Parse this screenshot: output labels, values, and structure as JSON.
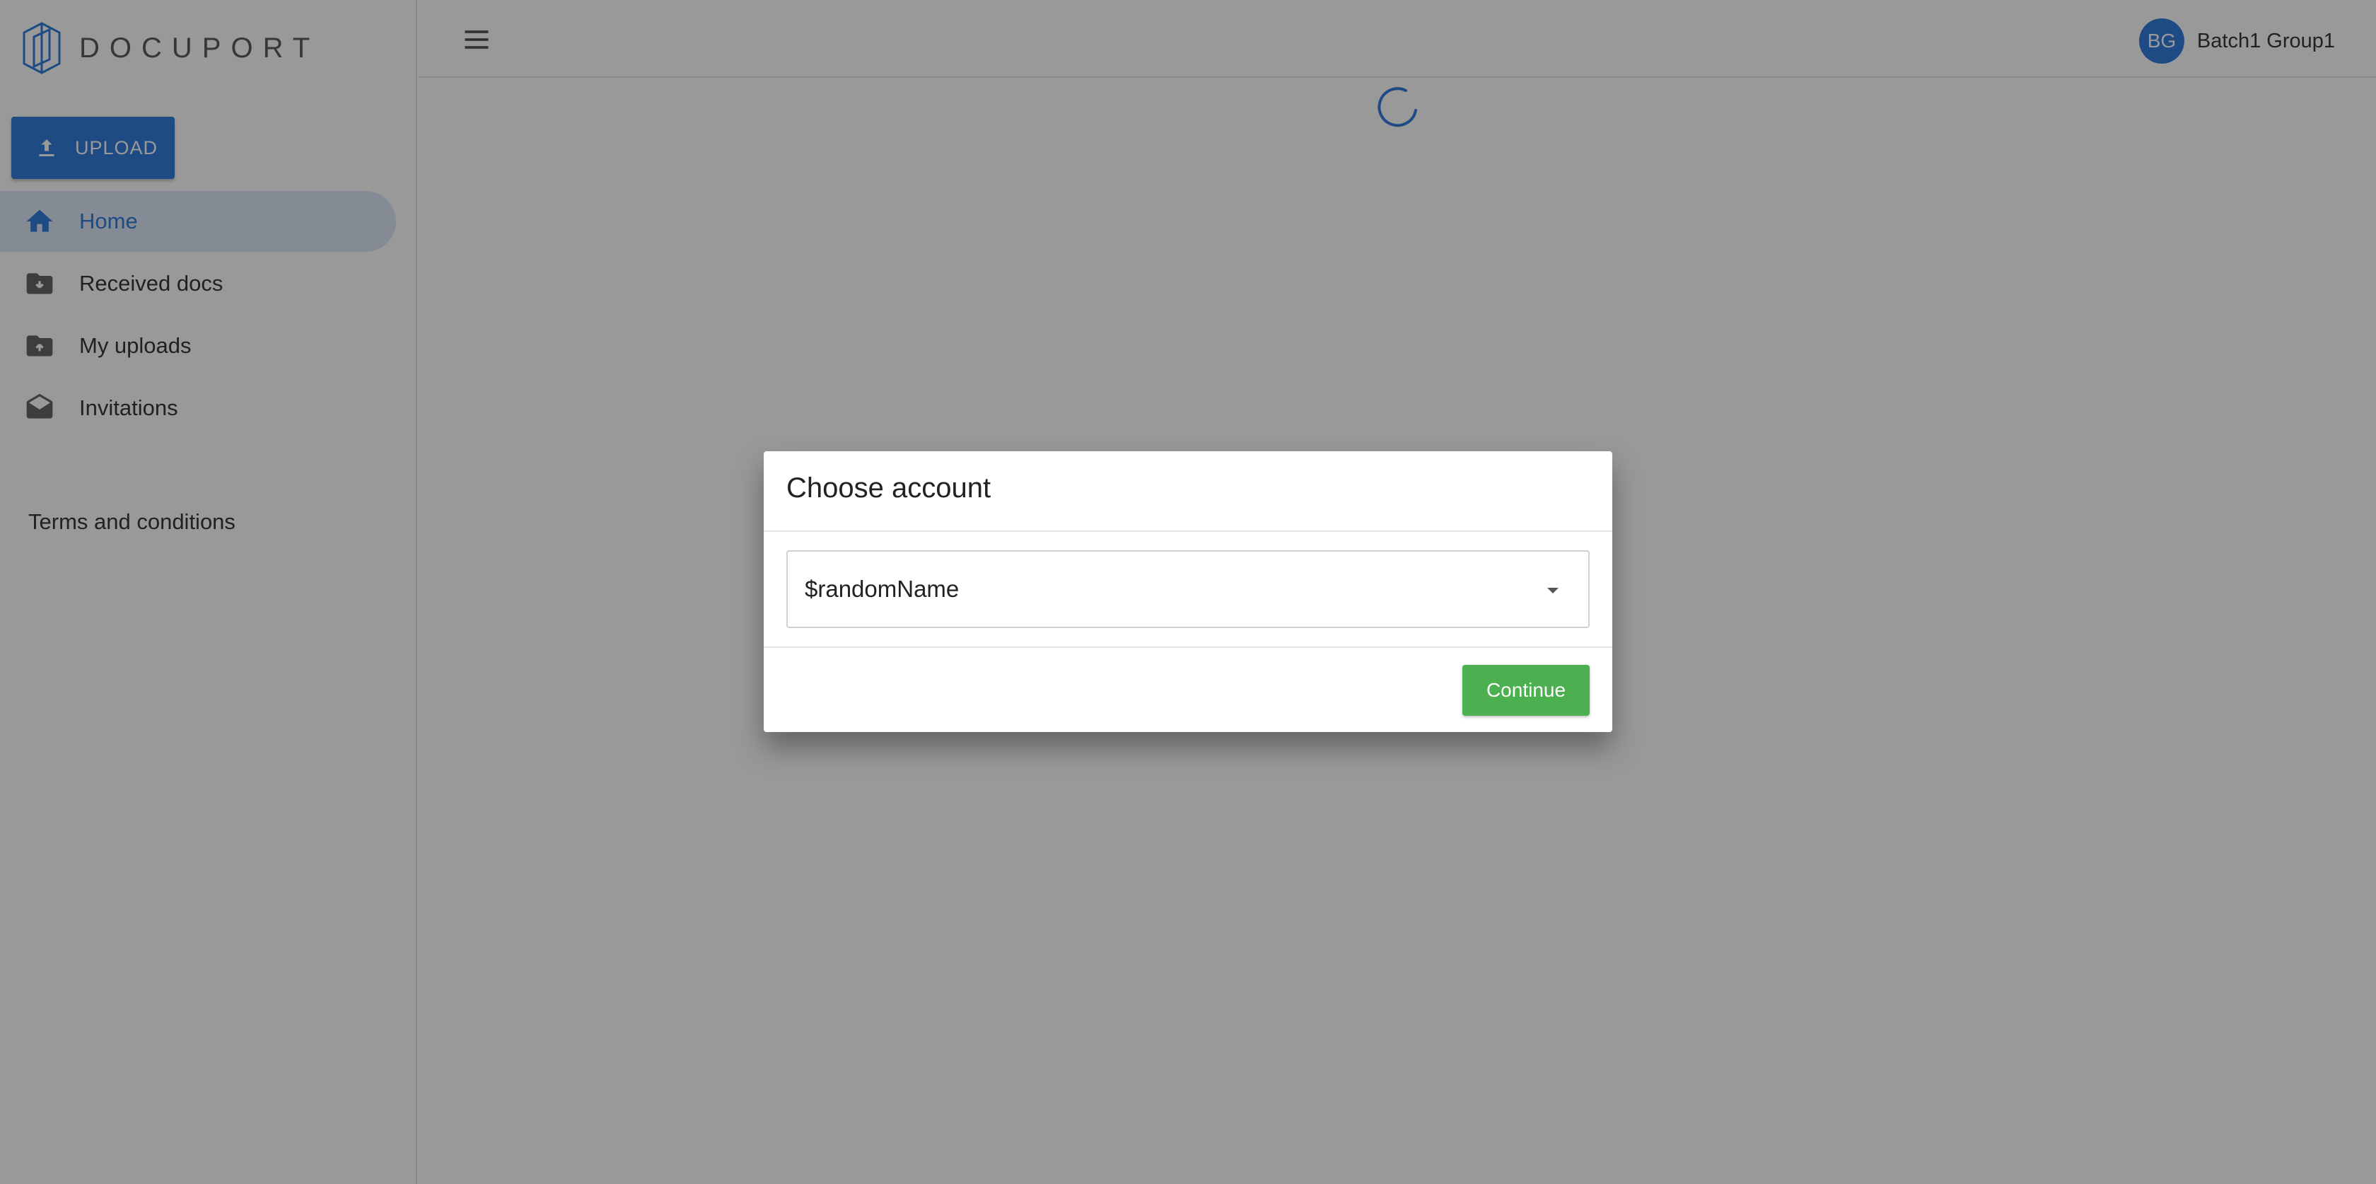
{
  "app": {
    "logo_text": "DOCUPORT"
  },
  "sidebar": {
    "upload_label": "UPLOAD",
    "items": [
      {
        "label": "Home",
        "icon": "home-icon",
        "active": true
      },
      {
        "label": "Received docs",
        "icon": "folder-download-icon",
        "active": false
      },
      {
        "label": "My uploads",
        "icon": "folder-upload-icon",
        "active": false
      },
      {
        "label": "Invitations",
        "icon": "envelope-open-icon",
        "active": false
      }
    ],
    "terms_label": "Terms and conditions"
  },
  "header": {
    "menu_icon": "hamburger-menu-icon",
    "user": {
      "initials": "BG",
      "name": "Batch1 Group1"
    }
  },
  "dialog": {
    "title": "Choose account",
    "select": {
      "value": "$randomName"
    },
    "continue_label": "Continue"
  },
  "colors": {
    "primary": "#1f6fd8",
    "success": "#4caf50",
    "active_bg": "#dbe6f5",
    "overlay": "rgba(33,33,33,0.46)"
  }
}
